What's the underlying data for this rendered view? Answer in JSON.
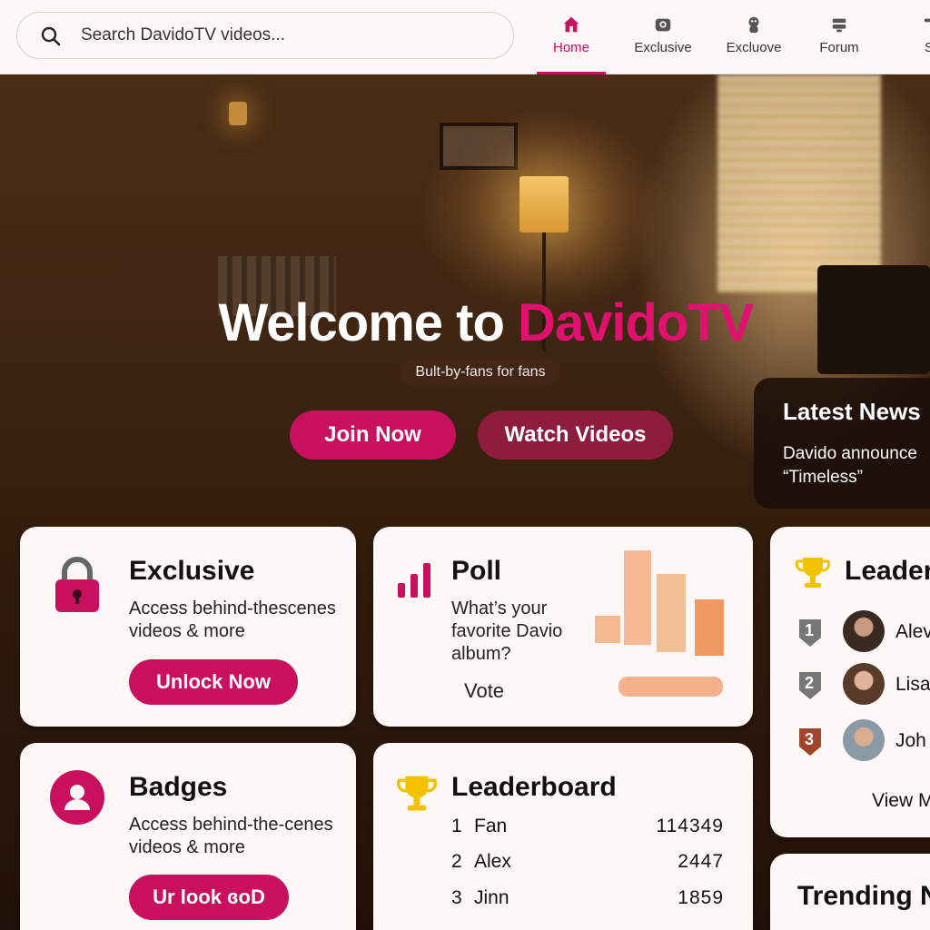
{
  "search": {
    "placeholder": "Search DavidoTV videos..."
  },
  "nav": {
    "tabs": [
      {
        "label": "Home",
        "icon": "home-icon",
        "active": true
      },
      {
        "label": "Exclusive",
        "icon": "camera-icon",
        "active": false
      },
      {
        "label": "Excluove",
        "icon": "user-icon",
        "active": false
      },
      {
        "label": "Forum",
        "icon": "forum-icon",
        "active": false
      },
      {
        "label": "S",
        "icon": "more-icon",
        "active": false
      }
    ]
  },
  "hero": {
    "title_prefix": "Welcome to ",
    "title_brand": "DavidoTV",
    "tagline": "Bult-by-fans for fans",
    "join_label": "Join Now",
    "watch_label": "Watch Videos"
  },
  "news": {
    "title": "Latest News",
    "line1": "Davido announce",
    "line2": "“Timeless”"
  },
  "exclusive": {
    "title": "Exclusive",
    "desc_line1": "Access behind-thescenes",
    "desc_line2": "videos & more",
    "button": "Unlock Now"
  },
  "poll": {
    "title": "Poll",
    "q1": "What’s your",
    "q2": "favorite Davio",
    "q3": "album?",
    "vote": "Vote"
  },
  "leader_side": {
    "title": "Leader",
    "rows": [
      {
        "rank": "1",
        "name": "Alev"
      },
      {
        "rank": "2",
        "name": "Lisa"
      },
      {
        "rank": "3",
        "name": "Joh"
      }
    ],
    "view": "View M"
  },
  "badges": {
    "title": "Badges",
    "desc_line1": "Access behind-the-cenes",
    "desc_line2": "videos & more",
    "button": "Ur look ɞoD"
  },
  "leaderboard": {
    "title": "Leaderboard",
    "rows": [
      {
        "rank": "1",
        "name": "Fan",
        "score": "114349"
      },
      {
        "rank": "2",
        "name": "Alex",
        "score": "2447"
      },
      {
        "rank": "3",
        "name": "Jinn",
        "score": "1859"
      }
    ]
  },
  "trending": {
    "title": "Trending N"
  },
  "colors": {
    "accent": "#c8105e",
    "brand": "#e0116f",
    "gold": "#f2c200"
  }
}
